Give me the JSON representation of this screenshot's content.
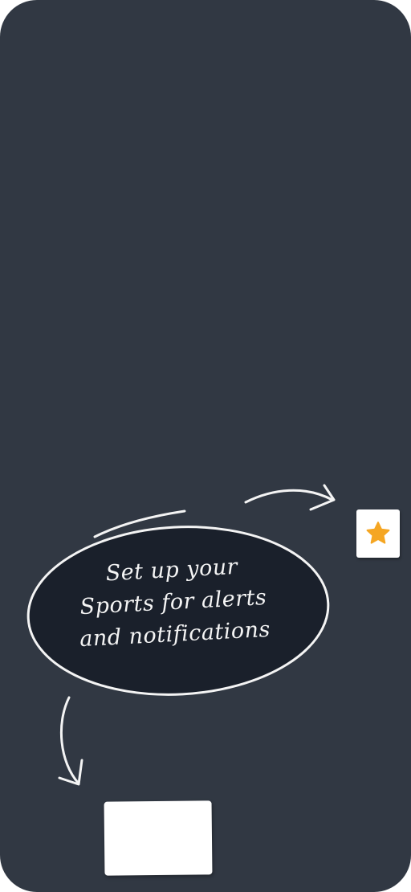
{
  "coach_mark": {
    "line1": "Set up your",
    "line2": "Sports for alerts",
    "line3": "and notifications"
  },
  "star_button": {
    "icon": "star-icon",
    "icon_color": "#f5a623"
  },
  "colors": {
    "overlay_background": "#313843",
    "bubble_fill": "#1a202b",
    "chalk": "#f4f4f4"
  }
}
